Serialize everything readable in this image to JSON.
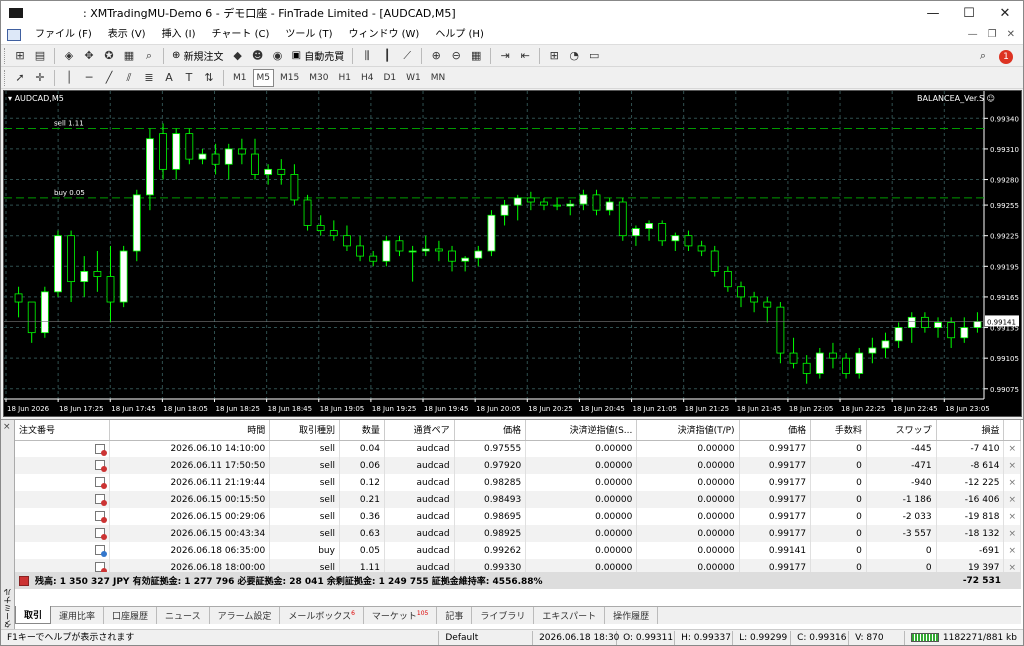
{
  "window": {
    "title": ": XMTradingMU-Demo 6 - デモ口座 - FinTrade Limited - [AUDCAD,M5]",
    "min": "—",
    "max": "☐",
    "close": "✕"
  },
  "menu": [
    "ファイル (F)",
    "表示 (V)",
    "挿入 (I)",
    "チャート (C)",
    "ツール (T)",
    "ウィンドウ (W)",
    "ヘルプ (H)"
  ],
  "toolbar": {
    "new_order": "新規注文",
    "auto_trade": "自動売買",
    "timeframes": [
      "M1",
      "M5",
      "M15",
      "M30",
      "H1",
      "H4",
      "D1",
      "W1",
      "MN"
    ],
    "active_tf": "M5",
    "notify_count": "1"
  },
  "chart": {
    "symbol": "AUDCAD,M5",
    "ea_label": "BALANCEA_Ver.S ☺"
  },
  "chart_data": {
    "type": "candlestick",
    "price_ticks": [
      "0.99340",
      "0.99310",
      "0.99280",
      "0.99255",
      "0.99225",
      "0.99195",
      "0.99165",
      "0.99135",
      "0.99105",
      "0.99075"
    ],
    "time_ticks": [
      "18 Jun 2026",
      "18 Jun 17:25",
      "18 Jun 17:45",
      "18 Jun 18:05",
      "18 Jun 18:25",
      "18 Jun 18:45",
      "18 Jun 19:05",
      "18 Jun 19:25",
      "18 Jun 19:45",
      "18 Jun 20:05",
      "18 Jun 20:25",
      "18 Jun 20:45",
      "18 Jun 21:05",
      "18 Jun 21:25",
      "18 Jun 21:45",
      "18 Jun 22:05",
      "18 Jun 22:25",
      "18 Jun 22:45",
      "18 Jun 23:05"
    ],
    "current_price": "0.99141",
    "level_lines": [
      {
        "label": "sell 1.11",
        "price": 0.9933
      },
      {
        "label": "buy 0.05",
        "price": 0.99262
      }
    ],
    "ylim": [
      0.99065,
      0.99355
    ],
    "candles": [
      [
        0.99168,
        0.99175,
        0.99145,
        0.9916
      ],
      [
        0.9916,
        0.9916,
        0.9912,
        0.9913
      ],
      [
        0.9913,
        0.99175,
        0.99125,
        0.9917
      ],
      [
        0.9917,
        0.9923,
        0.99165,
        0.99225
      ],
      [
        0.99225,
        0.9923,
        0.9916,
        0.9918
      ],
      [
        0.9918,
        0.99205,
        0.99165,
        0.9919
      ],
      [
        0.9919,
        0.9921,
        0.9917,
        0.99185
      ],
      [
        0.99185,
        0.99215,
        0.9914,
        0.9916
      ],
      [
        0.9916,
        0.99215,
        0.99155,
        0.9921
      ],
      [
        0.9921,
        0.9927,
        0.992,
        0.99265
      ],
      [
        0.99265,
        0.9933,
        0.9925,
        0.9932
      ],
      [
        0.99325,
        0.99335,
        0.9928,
        0.9929
      ],
      [
        0.9929,
        0.9933,
        0.9928,
        0.99325
      ],
      [
        0.99325,
        0.9933,
        0.99295,
        0.993
      ],
      [
        0.993,
        0.9931,
        0.99295,
        0.99305
      ],
      [
        0.99305,
        0.99315,
        0.99285,
        0.99295
      ],
      [
        0.99295,
        0.99315,
        0.9928,
        0.9931
      ],
      [
        0.9931,
        0.9932,
        0.99295,
        0.99305
      ],
      [
        0.99305,
        0.9932,
        0.9928,
        0.99285
      ],
      [
        0.99285,
        0.99295,
        0.99275,
        0.9929
      ],
      [
        0.9929,
        0.993,
        0.99275,
        0.99285
      ],
      [
        0.99285,
        0.99295,
        0.99255,
        0.9926
      ],
      [
        0.9926,
        0.99265,
        0.9923,
        0.99235
      ],
      [
        0.99235,
        0.99245,
        0.99225,
        0.9923
      ],
      [
        0.9923,
        0.9924,
        0.9922,
        0.99225
      ],
      [
        0.99225,
        0.99235,
        0.9921,
        0.99215
      ],
      [
        0.99215,
        0.99225,
        0.992,
        0.99205
      ],
      [
        0.99205,
        0.9921,
        0.99195,
        0.992
      ],
      [
        0.992,
        0.99225,
        0.99195,
        0.9922
      ],
      [
        0.9922,
        0.99225,
        0.99205,
        0.9921
      ],
      [
        0.9921,
        0.99215,
        0.9918,
        0.9921
      ],
      [
        0.9921,
        0.99225,
        0.99205,
        0.99212
      ],
      [
        0.99212,
        0.9922,
        0.992,
        0.9921
      ],
      [
        0.9921,
        0.99215,
        0.9919,
        0.992
      ],
      [
        0.992,
        0.99205,
        0.9919,
        0.99203
      ],
      [
        0.99203,
        0.99215,
        0.99195,
        0.9921
      ],
      [
        0.9921,
        0.9925,
        0.99205,
        0.99245
      ],
      [
        0.99245,
        0.9926,
        0.99235,
        0.99255
      ],
      [
        0.99255,
        0.99265,
        0.9924,
        0.99262
      ],
      [
        0.99262,
        0.99268,
        0.9925,
        0.99258
      ],
      [
        0.99258,
        0.99262,
        0.9925,
        0.99255
      ],
      [
        0.99255,
        0.99262,
        0.9925,
        0.99254
      ],
      [
        0.99254,
        0.9926,
        0.99245,
        0.99256
      ],
      [
        0.99256,
        0.9927,
        0.9925,
        0.99265
      ],
      [
        0.99265,
        0.9927,
        0.99245,
        0.9925
      ],
      [
        0.9925,
        0.99262,
        0.99245,
        0.99258
      ],
      [
        0.99258,
        0.99262,
        0.9922,
        0.99225
      ],
      [
        0.99225,
        0.99235,
        0.99215,
        0.99232
      ],
      [
        0.99232,
        0.9924,
        0.9922,
        0.99237
      ],
      [
        0.99237,
        0.9924,
        0.99215,
        0.9922
      ],
      [
        0.9922,
        0.99228,
        0.9921,
        0.99225
      ],
      [
        0.99225,
        0.9923,
        0.9921,
        0.99215
      ],
      [
        0.99215,
        0.9922,
        0.99205,
        0.9921
      ],
      [
        0.9921,
        0.99215,
        0.99185,
        0.9919
      ],
      [
        0.9919,
        0.99195,
        0.9917,
        0.99175
      ],
      [
        0.99175,
        0.9918,
        0.99155,
        0.99165
      ],
      [
        0.99165,
        0.9917,
        0.9915,
        0.9916
      ],
      [
        0.9916,
        0.99165,
        0.9914,
        0.99155
      ],
      [
        0.99155,
        0.9916,
        0.991,
        0.9911
      ],
      [
        0.9911,
        0.99125,
        0.99095,
        0.991
      ],
      [
        0.991,
        0.99108,
        0.9908,
        0.9909
      ],
      [
        0.9909,
        0.99115,
        0.99085,
        0.9911
      ],
      [
        0.9911,
        0.9912,
        0.99095,
        0.99105
      ],
      [
        0.99105,
        0.9911,
        0.99085,
        0.9909
      ],
      [
        0.9909,
        0.99115,
        0.99085,
        0.9911
      ],
      [
        0.9911,
        0.99125,
        0.991,
        0.99115
      ],
      [
        0.99115,
        0.9913,
        0.99105,
        0.99122
      ],
      [
        0.99122,
        0.9914,
        0.99115,
        0.99135
      ],
      [
        0.99135,
        0.9915,
        0.9912,
        0.99145
      ],
      [
        0.99145,
        0.9915,
        0.9913,
        0.99135
      ],
      [
        0.99135,
        0.99145,
        0.99125,
        0.9914
      ],
      [
        0.9914,
        0.99145,
        0.99115,
        0.99125
      ],
      [
        0.99125,
        0.99145,
        0.9912,
        0.99135
      ],
      [
        0.99135,
        0.9915,
        0.9913,
        0.99141
      ]
    ]
  },
  "orders": {
    "headers": [
      "注文番号",
      "時間",
      "取引種別",
      "数量",
      "通貨ペア",
      "価格",
      "決済逆指値(S...",
      "決済指値(T/P)",
      "価格",
      "手数料",
      "スワップ",
      "損益"
    ],
    "rows": [
      {
        "type": "sell",
        "time": "2026.06.10 14:10:00",
        "side": "sell",
        "lots": "0.04",
        "sym": "audcad",
        "price": "0.97555",
        "sl": "0.00000",
        "tp": "0.00000",
        "cur": "0.99177",
        "comm": "0",
        "swap": "-445",
        "profit": "-7 410"
      },
      {
        "type": "sell",
        "time": "2026.06.11 17:50:50",
        "side": "sell",
        "lots": "0.06",
        "sym": "audcad",
        "price": "0.97920",
        "sl": "0.00000",
        "tp": "0.00000",
        "cur": "0.99177",
        "comm": "0",
        "swap": "-471",
        "profit": "-8 614"
      },
      {
        "type": "sell",
        "time": "2026.06.11 21:19:44",
        "side": "sell",
        "lots": "0.12",
        "sym": "audcad",
        "price": "0.98285",
        "sl": "0.00000",
        "tp": "0.00000",
        "cur": "0.99177",
        "comm": "0",
        "swap": "-940",
        "profit": "-12 225"
      },
      {
        "type": "sell",
        "time": "2026.06.15 00:15:50",
        "side": "sell",
        "lots": "0.21",
        "sym": "audcad",
        "price": "0.98493",
        "sl": "0.00000",
        "tp": "0.00000",
        "cur": "0.99177",
        "comm": "0",
        "swap": "-1 186",
        "profit": "-16 406"
      },
      {
        "type": "sell",
        "time": "2026.06.15 00:29:06",
        "side": "sell",
        "lots": "0.36",
        "sym": "audcad",
        "price": "0.98695",
        "sl": "0.00000",
        "tp": "0.00000",
        "cur": "0.99177",
        "comm": "0",
        "swap": "-2 033",
        "profit": "-19 818"
      },
      {
        "type": "sell",
        "time": "2026.06.15 00:43:34",
        "side": "sell",
        "lots": "0.63",
        "sym": "audcad",
        "price": "0.98925",
        "sl": "0.00000",
        "tp": "0.00000",
        "cur": "0.99177",
        "comm": "0",
        "swap": "-3 557",
        "profit": "-18 132"
      },
      {
        "type": "buy",
        "time": "2026.06.18 06:35:00",
        "side": "buy",
        "lots": "0.05",
        "sym": "audcad",
        "price": "0.99262",
        "sl": "0.00000",
        "tp": "0.00000",
        "cur": "0.99141",
        "comm": "0",
        "swap": "0",
        "profit": "-691"
      },
      {
        "type": "sell",
        "time": "2026.06.18 18:00:00",
        "side": "sell",
        "lots": "1.11",
        "sym": "audcad",
        "price": "0.99330",
        "sl": "0.00000",
        "tp": "0.00000",
        "cur": "0.99177",
        "comm": "0",
        "swap": "0",
        "profit": "19 397"
      }
    ],
    "summary": "残高: 1 350 327 JPY  有効証拠金: 1 277 796  必要証拠金: 28 041  余剰証拠金: 1 249 755  証拠金維持率: 4556.88%",
    "total": "-72 531"
  },
  "terminal": {
    "side_label": "ターミナル",
    "close": "×"
  },
  "tabs": [
    {
      "label": "取引",
      "active": true
    },
    {
      "label": "運用比率"
    },
    {
      "label": "口座履歴"
    },
    {
      "label": "ニュース"
    },
    {
      "label": "アラーム設定"
    },
    {
      "label": "メールボックス",
      "badge": "6"
    },
    {
      "label": "マーケット",
      "badge": "105"
    },
    {
      "label": "記事"
    },
    {
      "label": "ライブラリ"
    },
    {
      "label": "エキスパート"
    },
    {
      "label": "操作履歴"
    }
  ],
  "status": {
    "help": "F1キーでヘルプが表示されます",
    "profile": "Default",
    "time": "2026.06.18 18:30",
    "o": "O: 0.99311",
    "h": "H: 0.99337",
    "l": "L: 0.99299",
    "c": "C: 0.99316",
    "v": "V: 870",
    "bars": "1182271/881 kb"
  },
  "colors": {
    "bull": "#ffffff",
    "bear": "#000000",
    "wick": "#00ff00",
    "grid": "#2f4f4f",
    "level": "#009900",
    "axis_text": "#ffffff"
  }
}
